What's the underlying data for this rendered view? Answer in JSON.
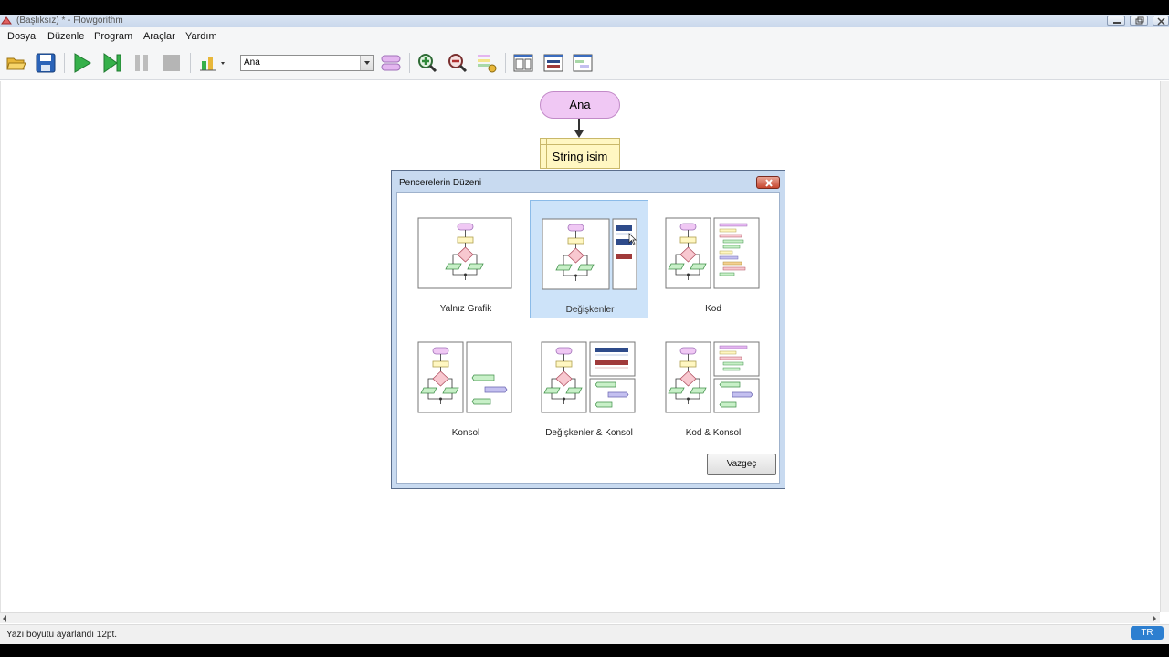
{
  "window": {
    "title": "(Başlıksız) * - Flowgorithm"
  },
  "menu": [
    "Dosya",
    "Düzenle",
    "Program",
    "Araçlar",
    "Yardım"
  ],
  "toolbar": {
    "function_select": "Ana"
  },
  "flowchart": {
    "start_label": "Ana",
    "declare_label": "String isim"
  },
  "dialog": {
    "title": "Pencerelerin Düzeni",
    "options": [
      {
        "label": "Yalnız Grafik",
        "selected": false
      },
      {
        "label": "Değişkenler",
        "selected": true
      },
      {
        "label": "Kod",
        "selected": false
      },
      {
        "label": "Konsol",
        "selected": false
      },
      {
        "label": "Değişkenler & Konsol",
        "selected": false
      },
      {
        "label": "Kod & Konsol",
        "selected": false
      }
    ],
    "cancel_label": "Vazgeç"
  },
  "status": {
    "text": "Yazı boyutu ayarlandı 12pt.",
    "language": "TR"
  },
  "colors": {
    "start": "#f0c8f4",
    "declare": "#fff7c2",
    "decision": "#f8c8d0",
    "io": "#c8f0c8",
    "variable_blue": "#2e4b8a",
    "variable_red": "#a03a3a",
    "selection": "#cde3f9"
  }
}
